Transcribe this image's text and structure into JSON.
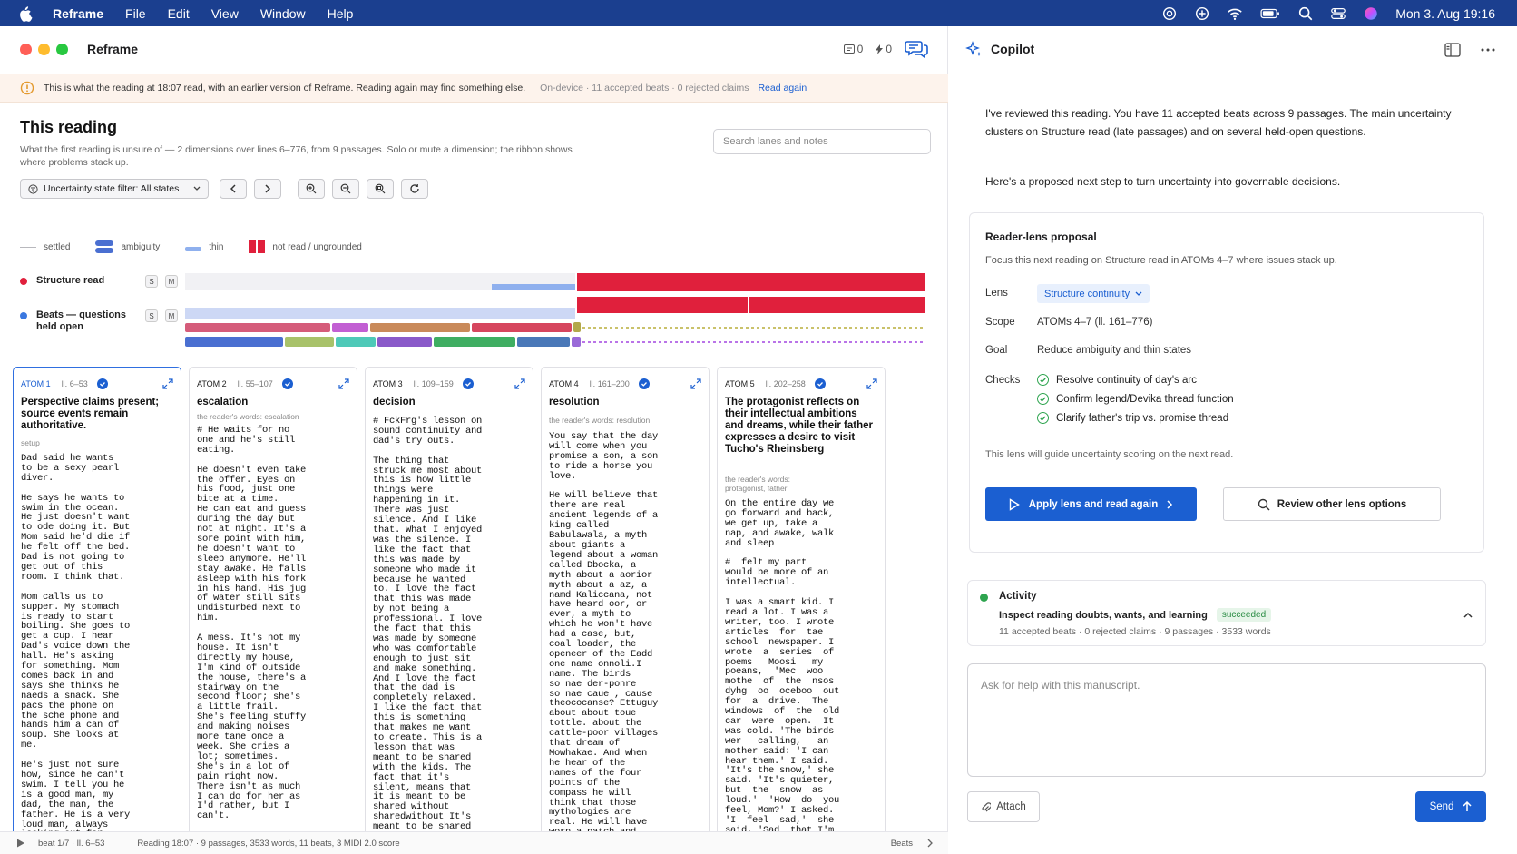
{
  "menubar": {
    "app": "Reframe",
    "items": [
      "File",
      "Edit",
      "View",
      "Window",
      "Help"
    ],
    "clock": "Mon 3. Aug  19:16"
  },
  "window": {
    "title": "Reframe",
    "counters": {
      "notes": "0",
      "flags": "0"
    }
  },
  "banner": {
    "text": "This is what the reading at 18:07 read, with an earlier version of Reframe. Reading again may find something else.",
    "meta": "On-device  ·  11 accepted beats  ·  0 rejected claims",
    "link": "Read again"
  },
  "reading": {
    "title": "This reading",
    "subtitle": "What the first reading is unsure of — 2 dimensions over lines 6–776, from 9 passages. Solo or mute a dimension; the ribbon shows where problems stack up.",
    "search_placeholder": "Search lanes and notes",
    "filter_label": "Uncertainty state filter: All states"
  },
  "legend": [
    {
      "label": "settled",
      "color": "#c7c7cc"
    },
    {
      "label": "ambiguity",
      "color": "#4a6fd1"
    },
    {
      "label": "thin",
      "color": "#8fb0ee"
    },
    {
      "label": "not read / ungrounded",
      "color": "#e0203c"
    }
  ],
  "lanes": [
    {
      "name": "Structure read",
      "color": "#e0203c",
      "solo": "S",
      "mute": "M"
    },
    {
      "name": "Beats — questions held open",
      "color": "#3a78e0",
      "solo": "S",
      "mute": "M"
    }
  ],
  "atoms": [
    {
      "label": "ATOM 1",
      "lines": "ll. 6–53",
      "title": "Perspective claims present; source events remain authoritative.",
      "tag": "setup",
      "body": "Dad said he wants\nto be a sexy pearl\ndiver.\n\nHe says he wants to\nswim in the ocean.\nHe just doesn't want\nto ode doing it. But\nMom said he'd die if\nhe felt off the bed.\nDad is not going to\nget out of this\nroom. I think that.\n\nMom calls us to\nsupper. My stomach\nis ready to start\nboiling. She goes to\nget a cup. I hear\nDad's voice down the\nhall. He's asking\nfor something. Mom\ncomes back in and\nsays she thinks he\nnaeds a snack. She\npacs the phone on\nthe sche phone and\nhands him a can of\nsoup. She looks at\nme.\n\nHe's just not sure\nhow, since he can't\nswim. I tell you he\nis a good man, my\ndad, the man, the\nfather. He is a very\nloud man, always\nlooking out for\nfather pope:. My\nanther is a very"
    },
    {
      "label": "ATOM 2",
      "lines": "ll. 55–107",
      "title": "escalation",
      "tag": "the reader's words: escalation",
      "body": "# He waits for no\none and he's still\neating.\n\nHe doesn't even take\nthe offer. Eyes on\nhis food, just one\nbite at a time.\nHe can eat and guess\nduring the day but\nnot at night. It's a\nsore point with him,\nhe doesn't want to\nsleep anymore. He'll\nstay awake. He falls\nasleep with his fork\nin his hand. His jug\nof water still sits\nundisturbed next to\nhim.\n\nA mess. It's not my\nhouse. It isn't\ndirectly my house,\nI'm kind of outside\nthe house, there's a\nstairway on the\nsecond floor; she's\na little frail.\nShe's feeling stuffy\nand making noises\nmore tane once a\nweek. She cries a\nlot; sometimes.\nShe's in a lot of\npain right now.\nThere isn't as much\nI can do for her as\nI'd rather, but I\ncan't."
    },
    {
      "label": "ATOM 3",
      "lines": "ll. 109–159",
      "title": "decision",
      "tag": "",
      "body": "# FckFrg's lesson on\nsound continuity and\ndad's try outs.\n\nThe thing that\nstruck me most about\nthis is how little\nthings were\nhappening in it.\nThere was just\nsilence. And I like\nthat. What I enjoyed\nwas the silence. I\nlike the fact that\nthis was made by\nsomeone who made it\nbecause he wanted\nto. I love the fact\nthat this was made\nby not being a\nprofessional. I love\nthe fact that this\nwas made by someone\nwho was comfortable\nenough to just sit\nand make something.\nAnd I love the fact\nthat the dad is\ncompletely relaxed.\nI like the fact that\nthis is something\nthat makes me want\nto create. This is a\nlesson that was\nmeant to be shared\nwith the kids. The\nfact that it's\nsilent, means that\nit is meant to be\nshared without\nsharedwithout It's\nmeant to be shared\nyou'rey where\nyou're just there to\nlisten and to"
    },
    {
      "label": "ATOM 4",
      "lines": "ll. 161–200",
      "title": "resolution",
      "tag": "the reader's words: resolution",
      "body": "You say that the day\nwill come when you\npromise a son, a son\nto ride a horse you\nlove.\n\nHe will believe that\nthere are real\nancient legends of a\nking called\nBabulawala, a myth\nabout giants a\nlegend about a woman\ncalled Dbocka, a\nmyth about a aorior\nmyth about a az, a\nnamd Kaliccana, not\nhave heard oor, or\never, a myth to\nwhich he won't have\nhad a case, but,\ncoal loader, the\nopeneer of the Eadd\none name onnoli.I\nname. The birds\nso nae der-ponre\nso nae caue , cause\ntheococanse? Ettuguy\nabout about toue\ntottle. about the\ncattle-poor villages\nthat dream of\nMowhakae. And when\nhe hear of the\nnames of the four\npoints of the\ncompass he will\nthink that those\nmythologies are\nreal. He will have\nworn a patch and\nhe'd sit to the pack\nof his land."
    },
    {
      "label": "ATOM 5",
      "lines": "ll. 202–258",
      "title": "The protagonist reflects on their intellectual ambitions and dreams, while their father expresses a desire to visit Tucho's Rheinsberg",
      "tag": "the reader's words: protagonist, father",
      "body": "On the entire day we\ngo forward and back,\nwe get up, take a\nnap, and awake, walk\nand sleep\n\n#  felt my part\nwould be more of an\nintellectual.\n\nI was a smart kid. I\nread a lot. I was a\nwriter, too. I wrote\narticles  for  tae\nschool  newspaper. I\nwrote  a  series  of\npoems   Moosi   my\npoeans,  'Mec  woo\nmothe  of  the  nsos\ndyhg  oo  oceboo  out\nfor  a  drive.  The\nwindows  of  the  old\ncar  were  open.  It\nwas cold. 'The birds\nwer   calling,   an\nmother said: 'I can\nhear them.' I said.\n'It's the snow,' she\nsaid. 'It's quieter,\nbut  the  snow  as\nloud.'  'How  do  you\nfeel, Mom?' I asked.\n'I  feel  sad,'  she\nsaid. 'Sad  that I'm\nleaving my family.' I\nfoaid med rorrion I-m"
    }
  ],
  "statusbar": {
    "beat": "beat 1/7  ·  ll. 6–53",
    "summary": "Reading 18:07 · 9 passages, 3533 words, 11 beats, 3 MIDI 2.0 score",
    "right": "Beats"
  },
  "copilot": {
    "title": "Copilot",
    "intro": "I've reviewed this reading. You have 11 accepted beats across 9 passages. The main uncertainty clusters on Structure read (late passages) and on several held-open questions.",
    "next": "Here's a proposed next step to turn uncertainty into governable decisions.",
    "proposal": {
      "title": "Reader-lens proposal",
      "desc": "Focus this next reading on Structure read in ATOMs 4–7 where issues stack up.",
      "lens_label": "Lens",
      "lens_value": "Structure continuity",
      "scope_label": "Scope",
      "scope_value": "ATOMs 4–7 (ll. 161–776)",
      "goal_label": "Goal",
      "goal_value": "Reduce ambiguity and thin states",
      "checks_label": "Checks",
      "checks": [
        "Resolve continuity of day's arc",
        "Confirm legend/Devika thread function",
        "Clarify father's trip vs. promise thread"
      ],
      "note": "This lens will guide uncertainty scoring on the next read.",
      "apply_label": "Apply lens and read again",
      "review_label": "Review other lens options"
    },
    "activity": {
      "title": "Activity",
      "task": "Inspect reading doubts, wants, and learning",
      "status": "succeeded",
      "meta": "11 accepted beats  ·  0 rejected claims  ·  9 passages  ·  3533 words"
    },
    "ask_placeholder": "Ask for help with this manuscript.",
    "attach_label": "Attach",
    "send_label": "Send"
  }
}
